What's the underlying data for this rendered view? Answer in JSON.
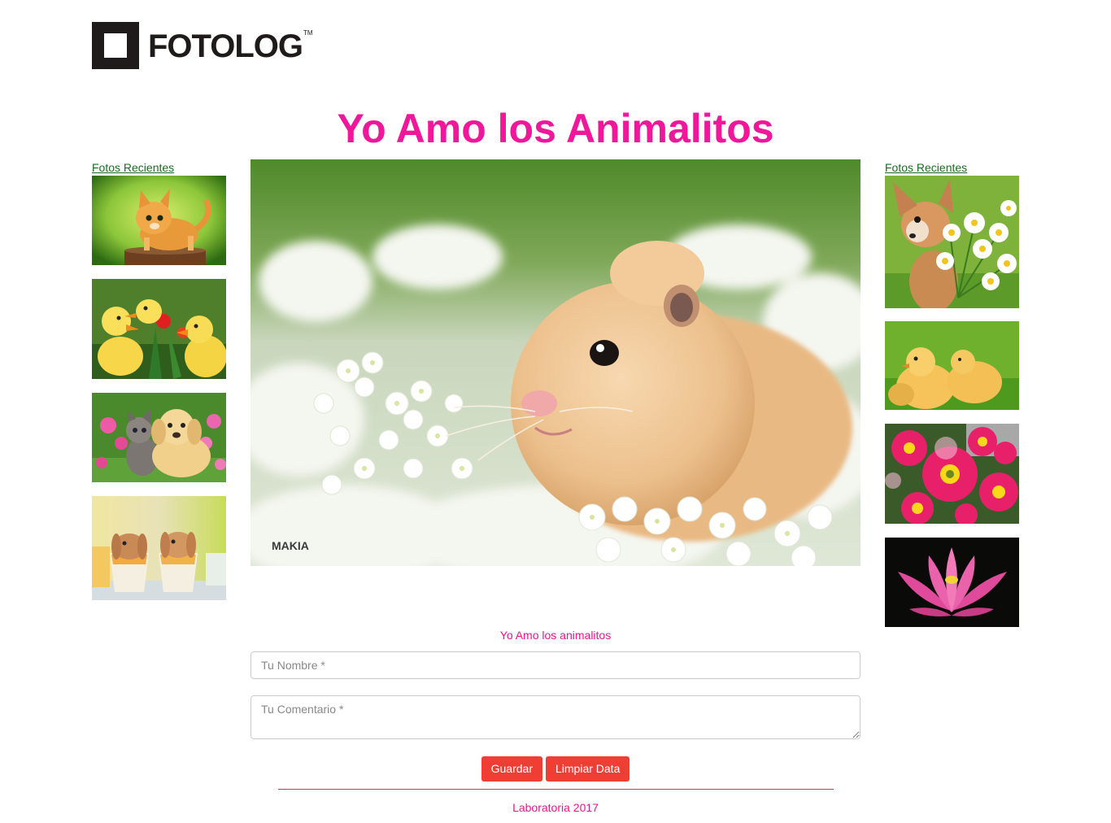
{
  "brand": {
    "name": "FOTOLOG",
    "trademark": "TM"
  },
  "page_title": "Yo Amo los Animalitos",
  "left_column": {
    "link_label": "Fotos Recientes",
    "photos": [
      {
        "subject": "orange kitten on a tree stump"
      },
      {
        "subject": "yellow ducklings among flowers"
      },
      {
        "subject": "kitten and puppy in flowers"
      },
      {
        "subject": "two bunnies in teacups"
      }
    ]
  },
  "right_column": {
    "link_label": "Fotos Recientes",
    "photos": [
      {
        "subject": "chihuahua holding daisies"
      },
      {
        "subject": "yellow chicks on grass"
      },
      {
        "subject": "pink gerbera daisies"
      },
      {
        "subject": "pink lotus flower"
      }
    ]
  },
  "main_photo": {
    "subject": "hamster in white flowers",
    "watermark": "MAKIA"
  },
  "form": {
    "caption": "Yo Amo los animalitos",
    "name_placeholder": "Tu Nombre *",
    "comment_placeholder": "Tu Comentario *",
    "save_label": "Guardar",
    "clear_label": "Limpiar Data"
  },
  "footer": {
    "text": "Laboratoria 2017"
  },
  "colors": {
    "title": "#f0179a",
    "link": "#1c6b24",
    "button": "#f03e35",
    "accent_text": "#e8168d"
  }
}
